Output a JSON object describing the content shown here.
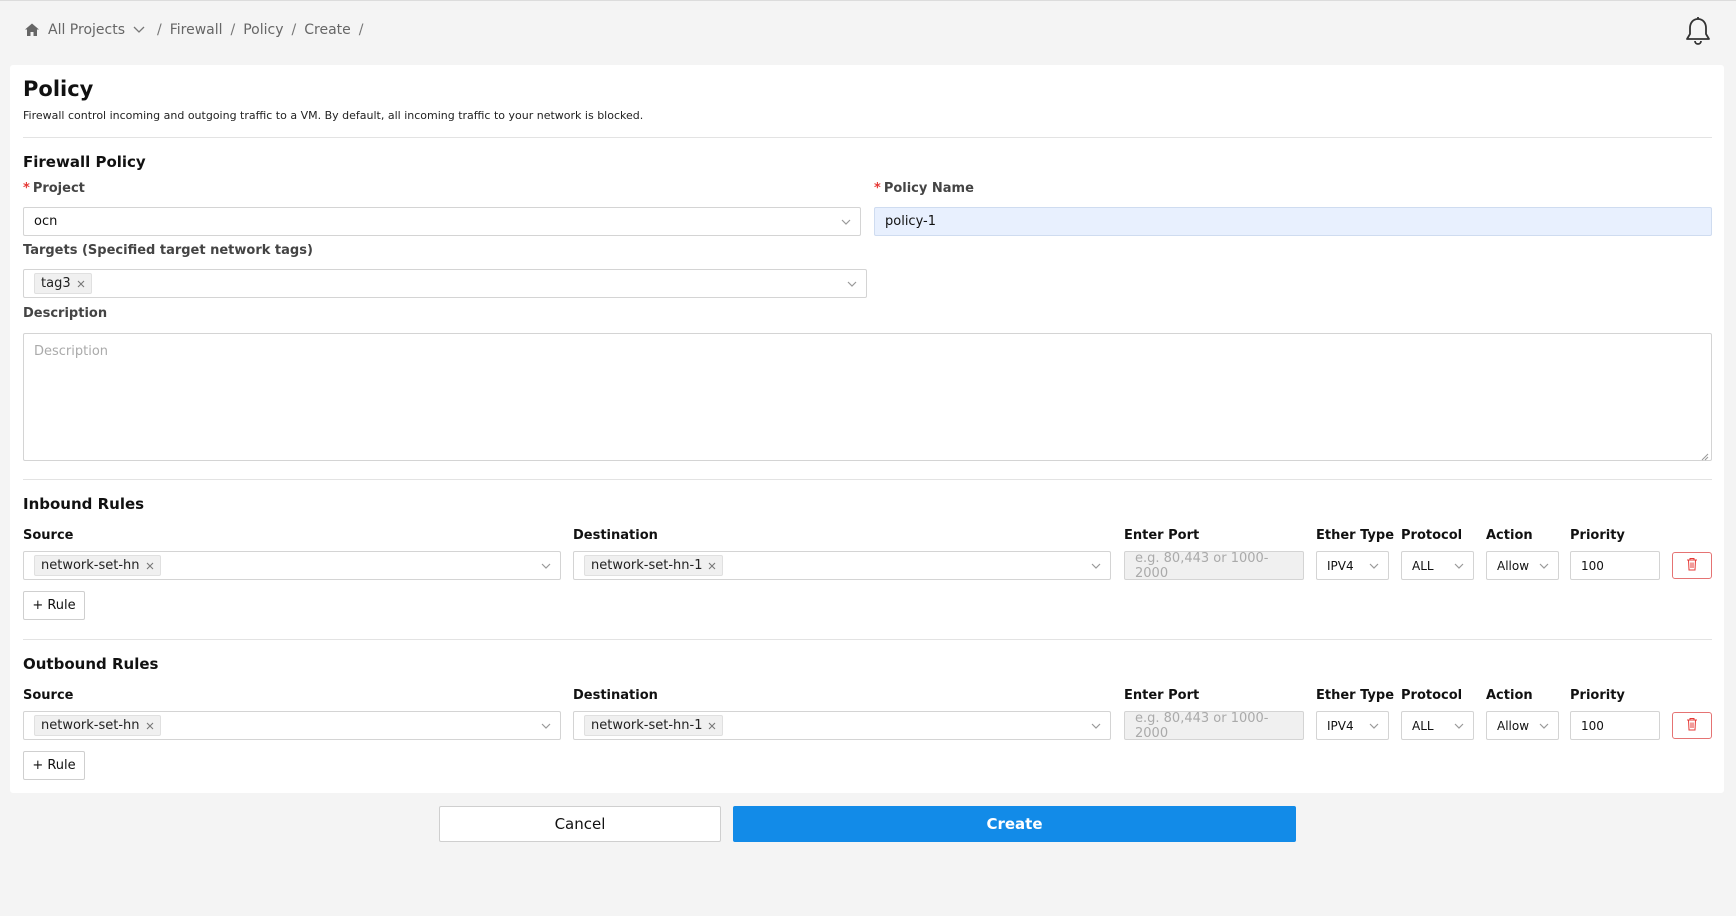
{
  "breadcrumb": {
    "all_projects": "All Projects",
    "items": [
      "Firewall",
      "Policy",
      "Create"
    ]
  },
  "page": {
    "title": "Policy",
    "description": "Firewall control incoming and outgoing traffic to a VM. By default, all incoming traffic to your network is blocked."
  },
  "firewall_policy": {
    "section_title": "Firewall Policy",
    "project_label": "Project",
    "project_value": "ocn",
    "policy_name_label": "Policy Name",
    "policy_name_value": "policy-1",
    "targets_label": "Targets (Specified target network tags)",
    "targets_tags": [
      "tag3"
    ],
    "description_label": "Description",
    "description_placeholder": "Description"
  },
  "rule_columns": {
    "source": "Source",
    "destination": "Destination",
    "port": "Enter Port",
    "ether_type": "Ether Type",
    "protocol": "Protocol",
    "action": "Action",
    "priority": "Priority"
  },
  "inbound": {
    "title": "Inbound Rules",
    "source_tag": "network-set-hn",
    "destination_tag": "network-set-hn-1",
    "port_placeholder": "e.g. 80,443 or 1000-2000",
    "ether_type": "IPV4",
    "protocol": "ALL",
    "action": "Allow",
    "priority": "100",
    "add_rule": "+ Rule"
  },
  "outbound": {
    "title": "Outbound Rules",
    "source_tag": "network-set-hn",
    "destination_tag": "network-set-hn-1",
    "port_placeholder": "e.g. 80,443 or 1000-2000",
    "ether_type": "IPV4",
    "protocol": "ALL",
    "action": "Allow",
    "priority": "100",
    "add_rule": "+ Rule"
  },
  "buttons": {
    "cancel": "Cancel",
    "create": "Create"
  },
  "colors": {
    "primary": "#128be8",
    "danger": "#e53935",
    "filled_input": "#e8f0fe"
  }
}
